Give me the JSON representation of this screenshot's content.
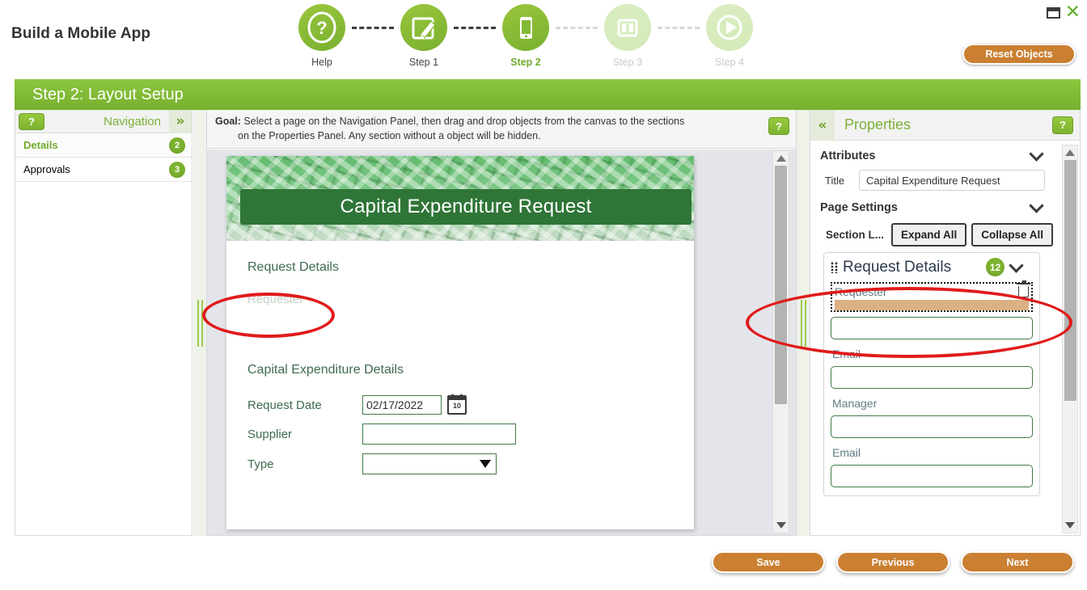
{
  "window": {
    "minimize_icon": "minimize-icon",
    "close_icon": "close-icon"
  },
  "header": {
    "app_title": "Build a Mobile App",
    "reset_button": "Reset Objects",
    "steps": [
      {
        "label": "Help",
        "icon": "question-mark-icon",
        "state": "normal"
      },
      {
        "label": "Step 1",
        "icon": "edit-pencil-icon",
        "state": "normal"
      },
      {
        "label": "Step 2",
        "icon": "mobile-phone-icon",
        "state": "active"
      },
      {
        "label": "Step 3",
        "icon": "layout-columns-icon",
        "state": "dim"
      },
      {
        "label": "Step 4",
        "icon": "play-icon",
        "state": "dim"
      }
    ]
  },
  "step_banner": {
    "title": "Step 2: Layout Setup"
  },
  "navigation": {
    "help_label": "?",
    "title": "Navigation",
    "collapse_icon": "chevron-double-right-icon",
    "items": [
      {
        "label": "Details",
        "badge": "2",
        "selected": true
      },
      {
        "label": "Approvals",
        "badge": "3",
        "selected": false
      }
    ]
  },
  "goal": {
    "prefix": "Goal:",
    "line1": " Select a page on the Navigation Panel, then drag and drop objects from the canvas to the sections",
    "line2": "on the Properties Panel. Any section without a object will be hidden.",
    "help_label": "?"
  },
  "canvas": {
    "form_title": "Capital Expenditure Request",
    "section_title": "Request Details",
    "ghost_field": "Requester",
    "details_title": "Capital Expenditure Details",
    "fields": [
      {
        "label": "Request Date",
        "value": "02/17/2022",
        "type": "date"
      },
      {
        "label": "Supplier",
        "value": "",
        "type": "text"
      },
      {
        "label": "Type",
        "value": "",
        "type": "select"
      }
    ],
    "calendar_icon": "calendar-icon",
    "calendar_day": "10"
  },
  "properties": {
    "expand_icon": "chevron-double-left-icon",
    "title": "Properties",
    "help_label": "?",
    "attributes_group": "Attributes",
    "title_field_label": "Title",
    "title_field_value": "Capital Expenditure Request",
    "page_settings_group": "Page Settings",
    "section_list_tab": "Section L...",
    "expand_all_button": "Expand All",
    "collapse_all_button": "Collapse All",
    "section": {
      "name": "Request Details",
      "badge": "12",
      "drag_item": {
        "label": "Requester",
        "trash_icon": "trash-icon"
      },
      "fields": [
        {
          "label": "Email"
        },
        {
          "label": "Manager"
        },
        {
          "label": "Email"
        }
      ]
    }
  },
  "footer": {
    "save": "Save",
    "previous": "Previous",
    "next": "Next"
  },
  "colors": {
    "green_accent": "#7db32f",
    "orange_button": "#ca7f31",
    "banner_green": "#2f7537",
    "drag_highlight": "#dbb184",
    "annotation_red": "#e01b1b"
  }
}
